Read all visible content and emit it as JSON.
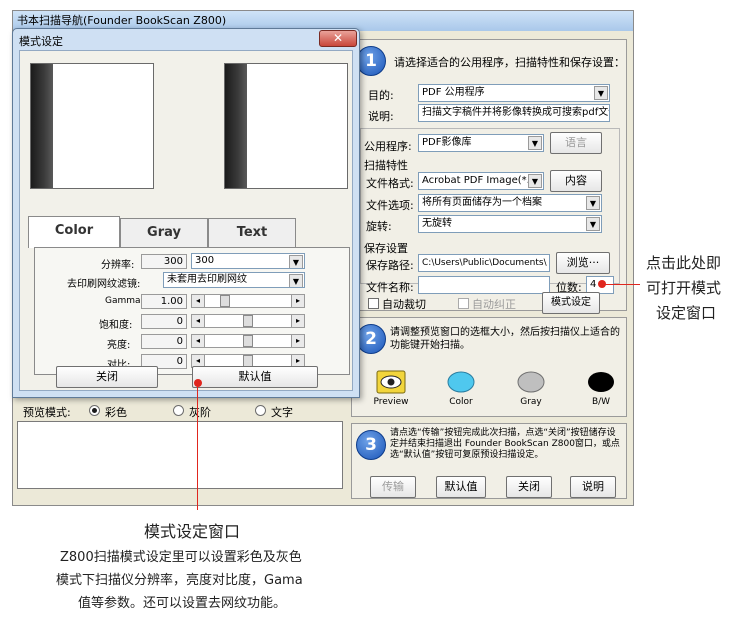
{
  "main_window": {
    "title": "书本扫描导航(Founder BookScan Z800)",
    "step1": {
      "number": "1",
      "heading": "请选择适合的公用程序，扫描特性和保存设置：",
      "purpose_label": "目的:",
      "purpose_value": "PDF 公用程序",
      "desc_label": "说明:",
      "desc_value": "扫描文字稿件并将影像转换成可搜索pdf文件",
      "app_label": "公用程序:",
      "app_value": "PDF影像库",
      "app_button": "语言",
      "props_label": "扫描特性",
      "format_label": "文件格式:",
      "format_value": "Acrobat PDF Image(*.p",
      "format_button": "内容",
      "fileopt_label": "文件选项:",
      "fileopt_value": "将所有页面储存为一个档案",
      "rotate_label": "旋转:",
      "rotate_value": "无旋转",
      "save_label": "保存设置",
      "savepath_label": "保存路径:",
      "savepath_value": "C:\\Users\\Public\\Documents\\",
      "browse_button": "浏览···",
      "filename_label": "文件名称:",
      "filename_value": "",
      "digits_label": "位数:",
      "digits_value": "4",
      "autocrop_label": "自动裁切",
      "autocorrect_label": "自动纠正",
      "mode_button": "模式设定"
    },
    "step2": {
      "number": "2",
      "text": "请调整预览窗口的选框大小，然后按扫描仪上适合的功能键开始扫描。",
      "icons": [
        {
          "icon": "eye-icon",
          "label": "Preview",
          "color": "#f2d53c"
        },
        {
          "icon": "color-icon",
          "label": "Color",
          "color": "#4fc8ee"
        },
        {
          "icon": "gray-icon",
          "label": "Gray",
          "color": "#bfbfbf"
        },
        {
          "icon": "bw-icon",
          "label": "B/W",
          "color": "#000000"
        }
      ]
    },
    "step3": {
      "number": "3",
      "text": "请点选“传输”按钮完成此次扫描，点选“关闭”按钮储存设定并结束扫描退出 Founder BookScan Z800窗口，或点选“默认值”按钮可复原预设扫描设定。",
      "buttons": [
        "传输",
        "默认值",
        "关闭",
        "说明"
      ]
    },
    "preview_mode": {
      "label": "预览模式:",
      "options": [
        "彩色",
        "灰阶",
        "文字"
      ],
      "selected": "彩色"
    }
  },
  "dialog": {
    "title": "模式设定",
    "close_glyph": "✕",
    "tabs": [
      "Color",
      "Gray",
      "Text"
    ],
    "active_tab": "Color",
    "resolution_label": "分辨率:",
    "resolution_box": "300",
    "resolution_select": "300",
    "descreen_label": "去印刷网纹滤镜:",
    "descreen_value": "未套用去印刷网纹",
    "gamma_label": "Gamma:",
    "gamma_value": "1.00",
    "saturation_label": "饱和度:",
    "saturation_value": "0",
    "brightness_label": "亮度:",
    "brightness_value": "0",
    "contrast_label": "对比:",
    "contrast_value": "0",
    "close_button": "关闭",
    "default_button": "默认值"
  },
  "annotations": {
    "right_callout": [
      "点击此处即",
      "可打开模式",
      "设定窗口"
    ],
    "caption_title": "模式设定窗口",
    "caption_lines": [
      "Z800扫描模式设定里可以设置彩色及灰色",
      "模式下扫描仪分辨率，亮度对比度，Gama",
      "值等参数。还可以设置去网纹功能。"
    ],
    "accent_color": "#e0261e"
  }
}
